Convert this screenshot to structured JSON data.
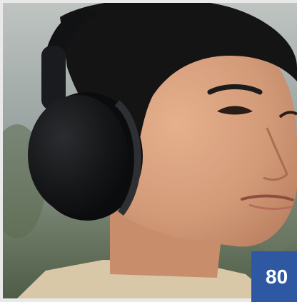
{
  "photo": {
    "subject": "person-with-headphones",
    "colors": {
      "skin": "#d9a07f",
      "hair": "#141414",
      "headphones": "#101113",
      "background": "#9aa39f",
      "badge": "#2f58a3"
    }
  },
  "badge": {
    "label": "80"
  }
}
